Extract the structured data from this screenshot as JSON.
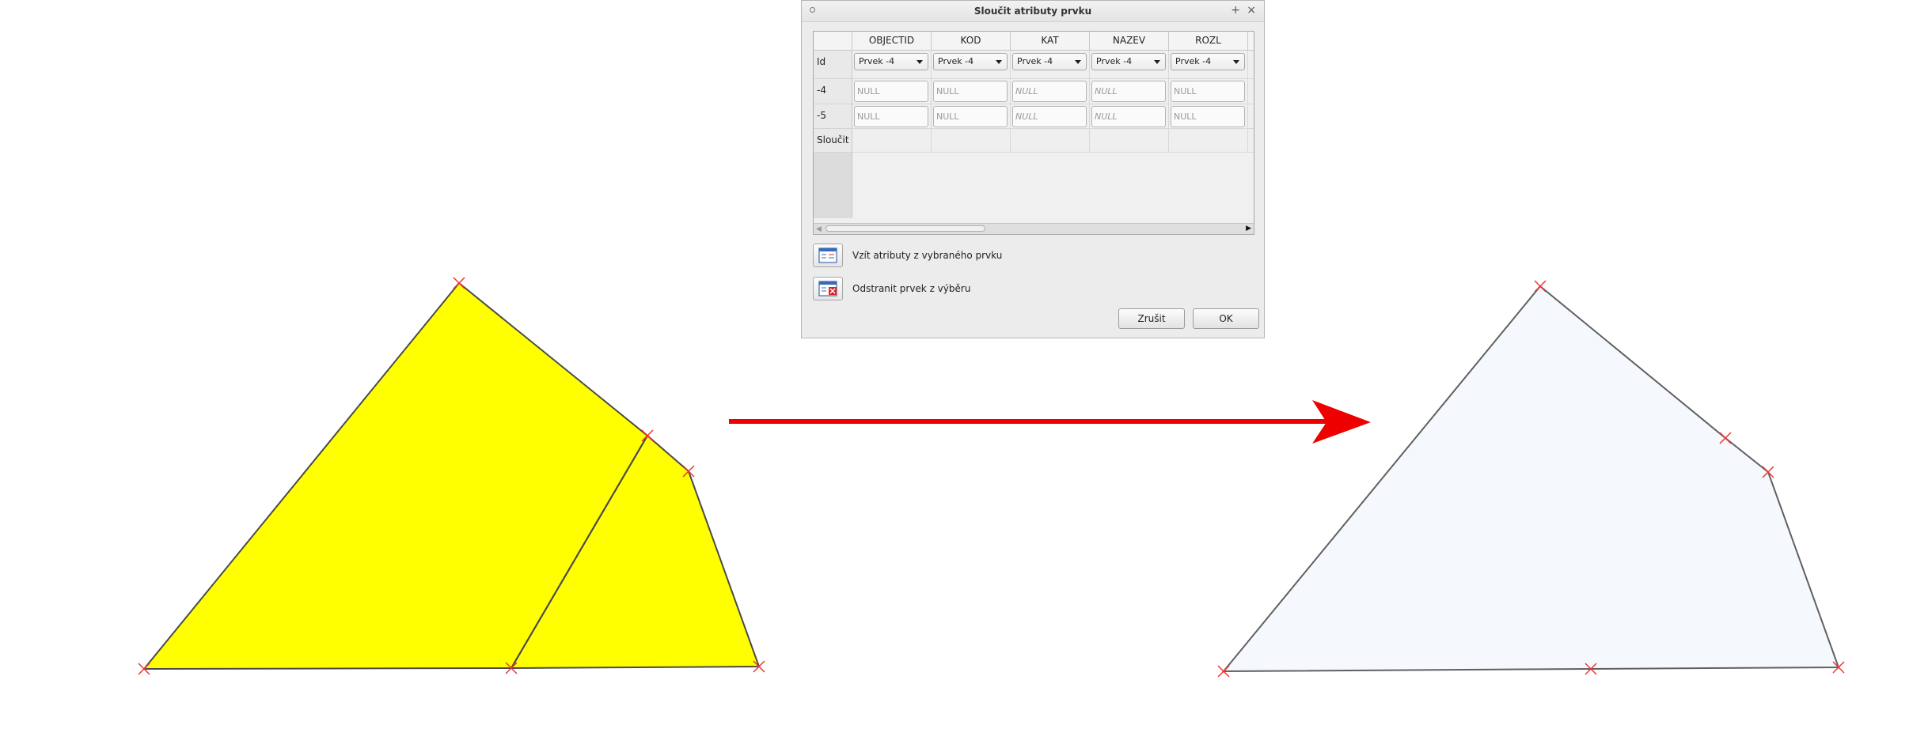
{
  "dialog": {
    "title": "Sloučit atributy prvku",
    "columns": [
      "OBJECTID",
      "KOD",
      "KAT",
      "NAZEV",
      "ROZL"
    ],
    "rows": [
      {
        "header": "Id",
        "kind": "combo",
        "cells": [
          "Prvek -4",
          "Prvek -4",
          "Prvek -4",
          "Prvek -4",
          "Prvek -4"
        ]
      },
      {
        "header": "-4",
        "kind": "null",
        "cells": [
          "NULL",
          "NULL",
          "NULL",
          "NULL",
          "NULL"
        ],
        "italic": [
          false,
          false,
          true,
          true,
          false
        ]
      },
      {
        "header": "-5",
        "kind": "null",
        "cells": [
          "NULL",
          "NULL",
          "NULL",
          "NULL",
          "NULL"
        ],
        "italic": [
          false,
          false,
          true,
          true,
          false
        ]
      },
      {
        "header": "Sloučit",
        "kind": "empty",
        "cells": [
          "",
          "",
          "",
          "",
          ""
        ]
      }
    ],
    "take_attributes_label": "Vzít atributy z vybraného prvku",
    "remove_feature_label": "Odstranit prvek z výběru",
    "cancel_label": "Zrušit",
    "ok_label": "OK",
    "pin_glyph": "+",
    "close_glyph": "×"
  },
  "map": {
    "before_fill": "#ffff00",
    "after_fill": "#f5f8fc",
    "outline": "#4a4a4a",
    "vertex_marker": "#ee3333",
    "arrow_color": "#ee0000",
    "icons": [
      "vertex-x-marker-icon",
      "arrow-right-icon",
      "attribute-table-icon",
      "remove-feature-icon"
    ]
  }
}
